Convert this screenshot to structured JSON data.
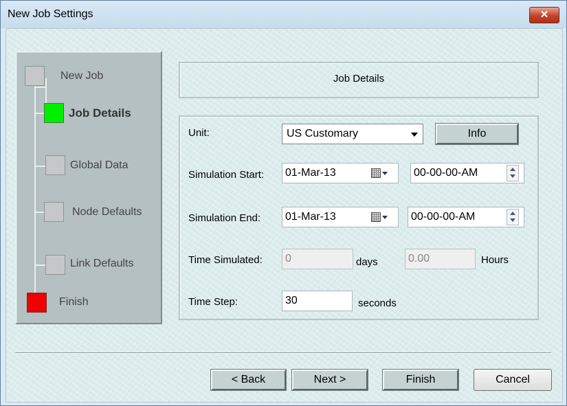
{
  "window": {
    "title": "New Job Settings",
    "close_label": "✕"
  },
  "wizard": {
    "steps": [
      {
        "label": "New Job",
        "state": "done"
      },
      {
        "label": "Job Details",
        "state": "current"
      },
      {
        "label": "Global Data",
        "state": "pending"
      },
      {
        "label": "Node Defaults",
        "state": "pending"
      },
      {
        "label": "Link Defaults",
        "state": "pending"
      },
      {
        "label": "Finish",
        "state": "final"
      }
    ],
    "colors": {
      "current": "#00ee00",
      "final": "#f00000",
      "pending": "#c5c7c9"
    }
  },
  "header": {
    "title": "Job Details"
  },
  "form": {
    "unit": {
      "label": "Unit:",
      "value": "US Customary",
      "info_label": "Info"
    },
    "sim_start": {
      "label": "Simulation Start:",
      "date": "01-Mar-13",
      "time": "00-00-00-AM"
    },
    "sim_end": {
      "label": "Simulation End:",
      "date": "01-Mar-13",
      "time": "00-00-00-AM"
    },
    "time_simulated": {
      "label": "Time Simulated:",
      "days_value": "0",
      "days_unit": "days",
      "hours_value": "0.00",
      "hours_unit": "Hours"
    },
    "time_step": {
      "label": "Time Step:",
      "value": "30",
      "unit": "seconds"
    }
  },
  "footer": {
    "back_label": "< Back",
    "next_label": "Next >",
    "finish_label": "Finish",
    "cancel_label": "Cancel"
  }
}
